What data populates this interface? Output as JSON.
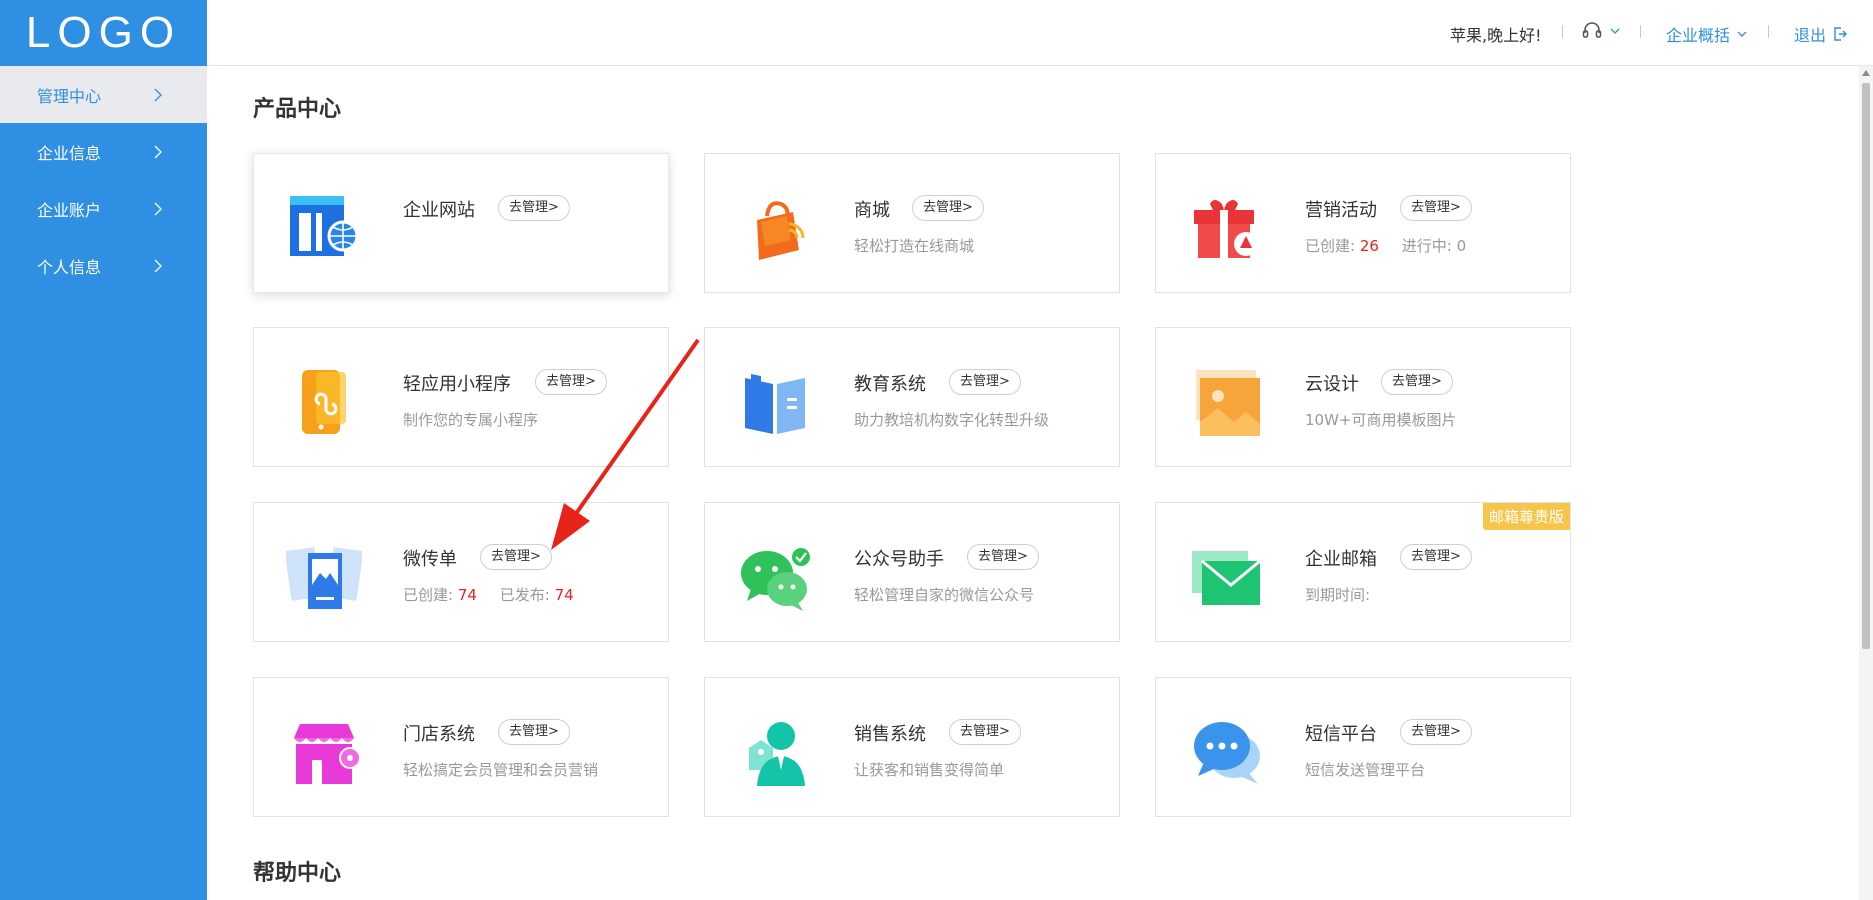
{
  "logo": "LOGO",
  "sidebar": {
    "items": [
      {
        "label": "管理中心",
        "active": true
      },
      {
        "label": "企业信息"
      },
      {
        "label": "企业账户"
      },
      {
        "label": "个人信息"
      }
    ]
  },
  "header": {
    "greeting": "苹果,晚上好!",
    "overview": "企业概括",
    "logout": "退出"
  },
  "product_center": {
    "title": "产品中心",
    "manage_label": "去管理>",
    "cards": [
      {
        "name": "企业网站",
        "icon": "website-icon"
      },
      {
        "name": "商城",
        "sub": "轻松打造在线商城",
        "icon": "shopping-bag-icon"
      },
      {
        "name": "营销活动",
        "created_label": "已创建:",
        "created_value": "26",
        "ongoing_label": "进行中:",
        "ongoing_value": "0",
        "icon": "gift-icon"
      },
      {
        "name": "轻应用小程序",
        "sub": "制作您的专属小程序",
        "icon": "mini-program-icon"
      },
      {
        "name": "教育系统",
        "sub": "助力教培机构数字化转型升级",
        "icon": "book-icon"
      },
      {
        "name": "云设计",
        "sub": "10W+可商用模板图片",
        "icon": "image-icon"
      },
      {
        "name": "微传单",
        "created_label": "已创建:",
        "created_value": "74",
        "published_label": "已发布:",
        "published_value": "74",
        "icon": "flyer-icon"
      },
      {
        "name": "公众号助手",
        "sub": "轻松管理自家的微信公众号",
        "icon": "wechat-icon"
      },
      {
        "name": "企业邮箱",
        "sub": "到期时间:",
        "badge": "邮箱尊贵版",
        "icon": "mail-icon"
      },
      {
        "name": "门店系统",
        "sub": "轻松搞定会员管理和会员营销",
        "icon": "store-icon"
      },
      {
        "name": "销售系统",
        "sub": "让获客和销售变得简单",
        "icon": "sales-person-icon"
      },
      {
        "name": "短信平台",
        "sub": "短信发送管理平台",
        "icon": "sms-icon"
      }
    ]
  },
  "help_center": {
    "title": "帮助中心"
  },
  "colors": {
    "sidebar": "#2f8fe3",
    "accent": "#2f8fe3",
    "highlight": "#e8231a",
    "badge": "#f6c64a",
    "arrow": "#e8231a"
  }
}
